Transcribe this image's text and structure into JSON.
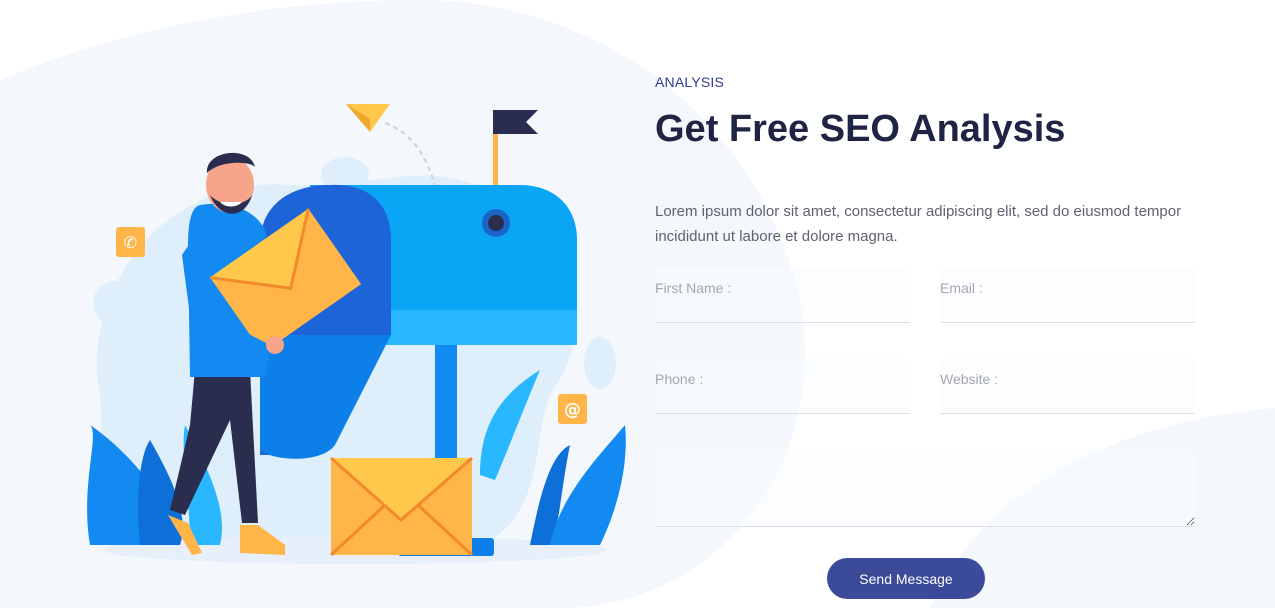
{
  "section": {
    "eyebrow": "ANALYSIS",
    "title": "Get Free SEO Analysis",
    "description": "Lorem ipsum dolor sit amet, consectetur adipiscing elit, sed do eiusmod tempor incididunt ut labore et dolore magna."
  },
  "form": {
    "first_name_placeholder": "First Name :",
    "email_placeholder": "Email :",
    "phone_placeholder": "Phone :",
    "website_placeholder": "Website :",
    "message_placeholder": "",
    "submit_label": "Send Message"
  },
  "colors": {
    "accent": "#3b4a99",
    "title": "#1f2344",
    "mailbox_blue": "#0ba5f5",
    "envelope_orange": "#ffb547"
  },
  "icons": [
    "paper-plane-icon",
    "flag-icon",
    "phone-icon",
    "at-icon",
    "envelope-icon",
    "mailbox-icon"
  ]
}
